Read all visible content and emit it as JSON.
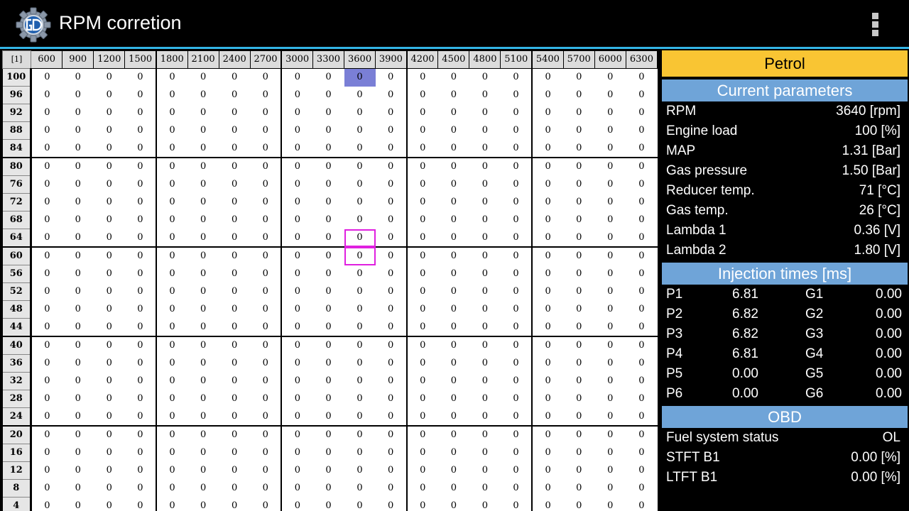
{
  "app": {
    "title": "RPM corretion",
    "logo_icon": "gear-gd-logo-icon",
    "overflow_icon": "overflow-menu-icon",
    "accent_color": "#33b5e5"
  },
  "map": {
    "corner_label": "[1]",
    "rpm_columns": [
      "600",
      "900",
      "1200",
      "1500",
      "1800",
      "2100",
      "2400",
      "2700",
      "3000",
      "3300",
      "3600",
      "3900",
      "4200",
      "4500",
      "4800",
      "5100",
      "5400",
      "5700",
      "6000",
      "6300"
    ],
    "load_rows": [
      "100",
      "96",
      "92",
      "88",
      "84",
      "80",
      "76",
      "72",
      "68",
      "64",
      "60",
      "56",
      "52",
      "48",
      "44",
      "40",
      "36",
      "32",
      "28",
      "24",
      "20",
      "16",
      "12",
      "8",
      "4"
    ],
    "cell_value": "0",
    "highlighted_cell": {
      "row": "100",
      "column": "3600",
      "color": "#7a7fd6"
    },
    "cursor_cells": [
      {
        "row": "64",
        "column": "3600"
      },
      {
        "row": "60",
        "column": "3600"
      }
    ],
    "cursor_color": "#e020e0"
  },
  "panel": {
    "fuel_mode": "Petrol",
    "fuel_mode_color": "#f9c533",
    "section_color": "#6fa4d8",
    "current_parameters": {
      "heading": "Current parameters",
      "rows": [
        {
          "label": "RPM",
          "value": "3640 [rpm]"
        },
        {
          "label": "Engine load",
          "value": "100 [%]"
        },
        {
          "label": "MAP",
          "value": "1.31 [Bar]"
        },
        {
          "label": "Gas pressure",
          "value": "1.50 [Bar]"
        },
        {
          "label": "Reducer temp.",
          "value": "71 [°C]"
        },
        {
          "label": "Gas temp.",
          "value": "26 [°C]"
        },
        {
          "label": "Lambda 1",
          "value": "0.36 [V]"
        },
        {
          "label": "Lambda 2",
          "value": "1.80 [V]"
        }
      ]
    },
    "injection_times": {
      "heading": "Injection times [ms]",
      "rows": [
        {
          "p_label": "P1",
          "p_value": "6.81",
          "g_label": "G1",
          "g_value": "0.00"
        },
        {
          "p_label": "P2",
          "p_value": "6.82",
          "g_label": "G2",
          "g_value": "0.00"
        },
        {
          "p_label": "P3",
          "p_value": "6.82",
          "g_label": "G3",
          "g_value": "0.00"
        },
        {
          "p_label": "P4",
          "p_value": "6.81",
          "g_label": "G4",
          "g_value": "0.00"
        },
        {
          "p_label": "P5",
          "p_value": "0.00",
          "g_label": "G5",
          "g_value": "0.00"
        },
        {
          "p_label": "P6",
          "p_value": "0.00",
          "g_label": "G6",
          "g_value": "0.00"
        }
      ]
    },
    "obd": {
      "heading": "OBD",
      "rows": [
        {
          "label": "Fuel system status",
          "value": "OL"
        },
        {
          "label": "STFT B1",
          "value": "0.00 [%]"
        },
        {
          "label": "LTFT B1",
          "value": "0.00 [%]"
        }
      ]
    }
  }
}
